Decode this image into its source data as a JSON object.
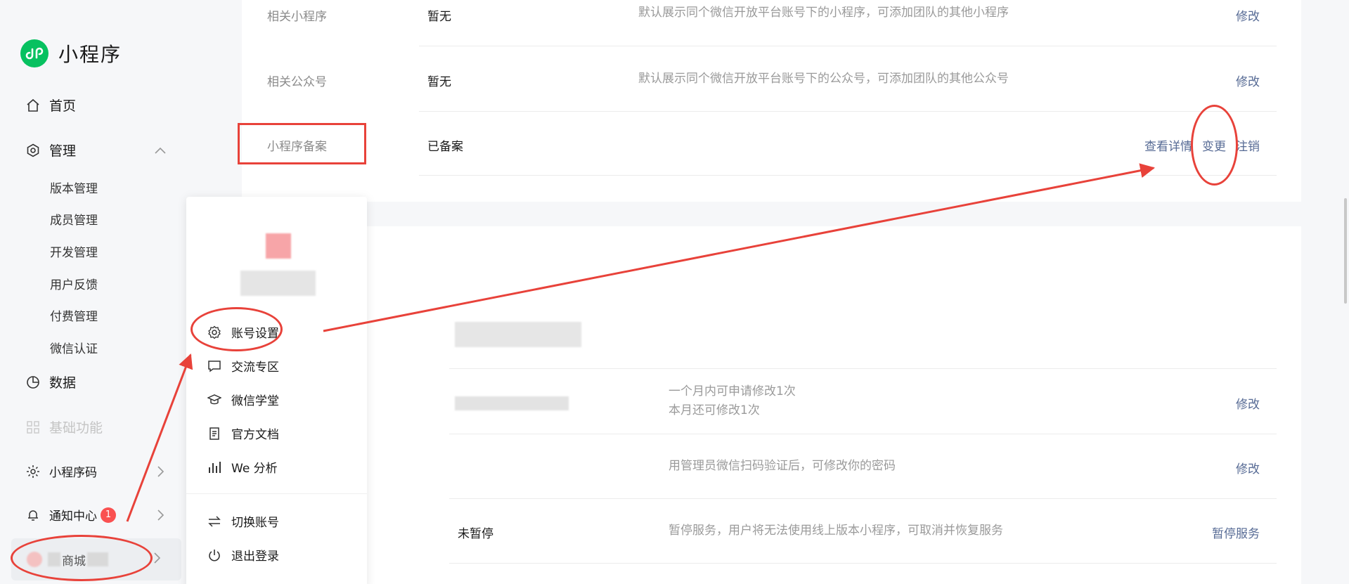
{
  "app": {
    "title": "小程序"
  },
  "sidebar": {
    "home": "首页",
    "manage": "管理",
    "manage_sub": [
      "版本管理",
      "成员管理",
      "开发管理",
      "用户反馈",
      "付费管理",
      "微信认证"
    ],
    "data": "数据",
    "basic": "基础功能",
    "qrcode": "小程序码",
    "notice": "通知中心",
    "notice_badge": "1",
    "account_name": "商城"
  },
  "settings_rows": [
    {
      "label": "相关小程序",
      "value": "暂无",
      "desc": "默认展示同个微信开放平台账号下的小程序，可添加团队的其他小程序",
      "action": "修改"
    },
    {
      "label": "相关公众号",
      "value": "暂无",
      "desc": "默认展示同个微信开放平台账号下的公众号，可添加团队的其他公众号",
      "action": "修改"
    },
    {
      "label": "小程序备案",
      "value": "已备案",
      "actions": [
        "查看详情",
        "变更",
        "注销"
      ]
    }
  ],
  "account_rows": [
    {
      "desc_lines": [
        "一个月内可申请修改1次",
        "本月还可修改1次"
      ],
      "action": "修改"
    },
    {
      "desc": "用管理员微信扫码验证后，可修改你的密码",
      "action": "修改"
    },
    {
      "value": "未暂停",
      "desc": "暂停服务，用户将无法使用线上版本小程序，可取消并恢复服务",
      "action": "暂停服务"
    }
  ],
  "menu": {
    "items": [
      "账号设置",
      "交流专区",
      "微信学堂",
      "官方文档",
      "We 分析"
    ],
    "bottom": [
      "切换账号",
      "退出登录"
    ]
  },
  "colors": {
    "accent": "#07c160",
    "link": "#576b95",
    "annotation": "#e8423a",
    "badge": "#fa5151"
  }
}
